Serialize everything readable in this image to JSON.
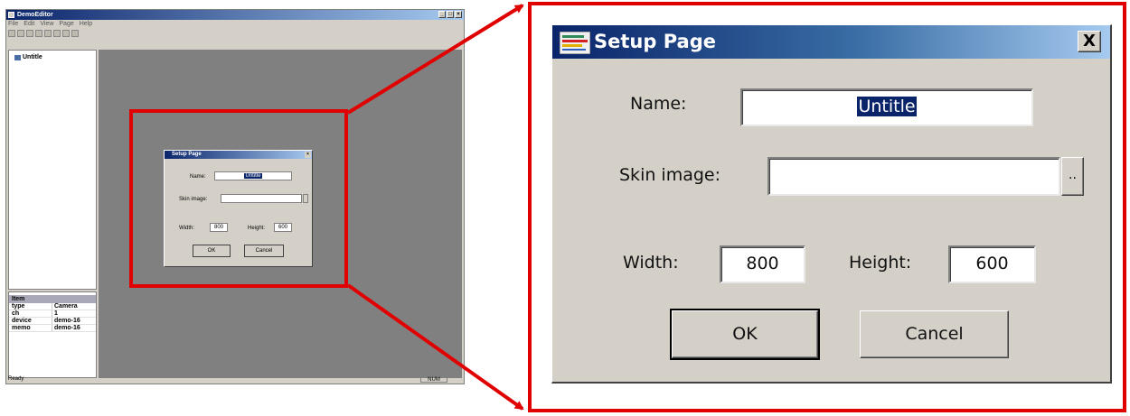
{
  "app": {
    "title": "DemoEditor",
    "menu": [
      "File",
      "Edit",
      "View",
      "Page",
      "Help"
    ],
    "tree_root": "Untitle",
    "props_header": "Item",
    "props": [
      {
        "key": "type",
        "value": "Camera"
      },
      {
        "key": "ch",
        "value": "1"
      },
      {
        "key": "device",
        "value": "demo-16"
      },
      {
        "key": "memo",
        "value": "demo-16"
      }
    ],
    "status": "Ready",
    "status_num": "NUM"
  },
  "dialog": {
    "title": "Setup Page",
    "close_glyph": "X",
    "name_label": "Name:",
    "name_value": "Untitle",
    "skin_label": "Skin image:",
    "skin_value": "",
    "browse_label": "..",
    "width_label": "Width:",
    "width_value": "800",
    "height_label": "Height:",
    "height_value": "600",
    "ok_label": "OK",
    "cancel_label": "Cancel"
  },
  "colors": {
    "highlight": "#e00000",
    "titlebar_start": "#0a246a",
    "titlebar_end": "#a6caf0",
    "dialog_face": "#d4d0c8",
    "canvas": "#808080"
  }
}
